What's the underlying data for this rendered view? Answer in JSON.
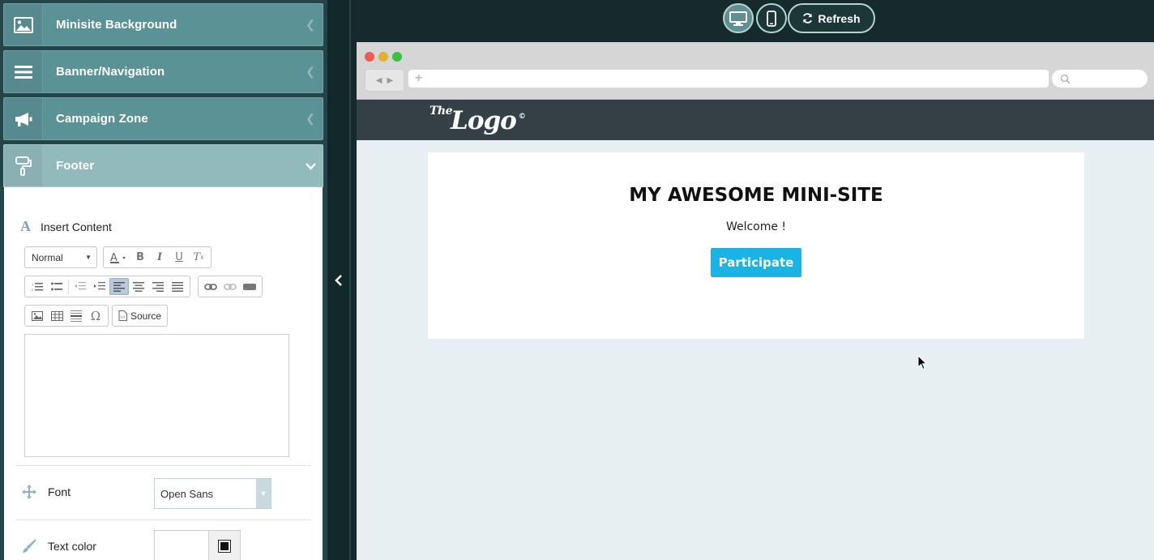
{
  "sidebar": {
    "accordions": [
      {
        "label": "Minisite Background",
        "icon": "image-icon"
      },
      {
        "label": "Banner/Navigation",
        "icon": "menu-icon"
      },
      {
        "label": "Campaign Zone",
        "icon": "megaphone-icon"
      },
      {
        "label": "Footer",
        "icon": "paint-roller-icon",
        "open": true
      }
    ],
    "footer_panel": {
      "section_title": "Insert Content",
      "format_select": "Normal",
      "source_label": "Source",
      "font_label": "Font",
      "font_value": "Open Sans",
      "text_color_label": "Text color"
    }
  },
  "device_toolbar": {
    "refresh_label": "Refresh",
    "active_device": "desktop"
  },
  "preview": {
    "logo_small": "The",
    "logo_big": "Logo",
    "logo_mark": "©",
    "title": "MY AWESOME MINI-SITE",
    "welcome": "Welcome !",
    "button_label": "Participate"
  },
  "colors": {
    "accent": "#1ab3e4",
    "panel_header": "#5b9296",
    "panel_header_open": "#92babd",
    "site_header": "#343f46"
  }
}
